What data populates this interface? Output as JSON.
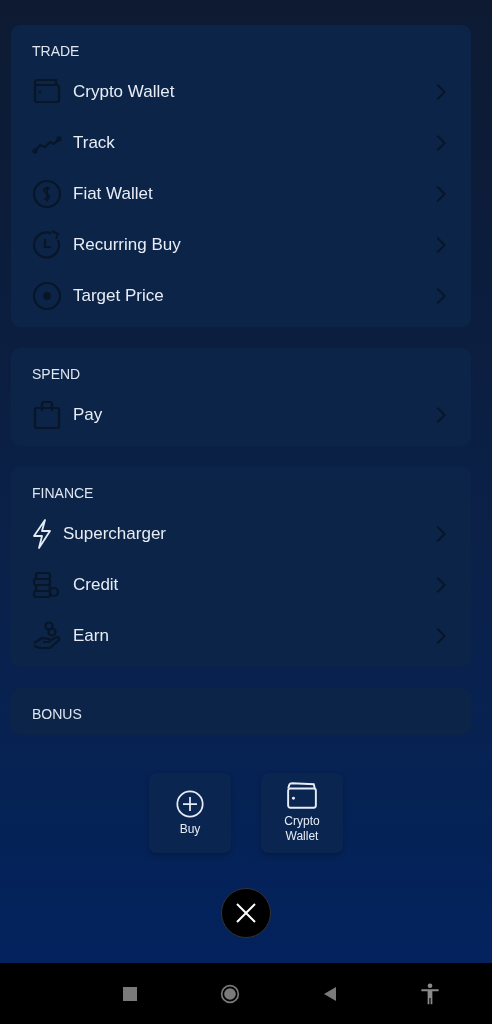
{
  "sections": [
    {
      "title": "TRADE",
      "items": [
        {
          "label": "Crypto Wallet"
        },
        {
          "label": "Track"
        },
        {
          "label": "Fiat Wallet"
        },
        {
          "label": "Recurring Buy"
        },
        {
          "label": "Target Price"
        }
      ]
    },
    {
      "title": "SPEND",
      "items": [
        {
          "label": "Pay"
        }
      ]
    },
    {
      "title": "FINANCE",
      "items": [
        {
          "label": "Supercharger"
        },
        {
          "label": "Credit"
        },
        {
          "label": "Earn"
        }
      ]
    },
    {
      "title": "BONUS"
    }
  ],
  "quick_actions": [
    {
      "label": "Buy"
    },
    {
      "label": "Crypto Wallet"
    }
  ]
}
